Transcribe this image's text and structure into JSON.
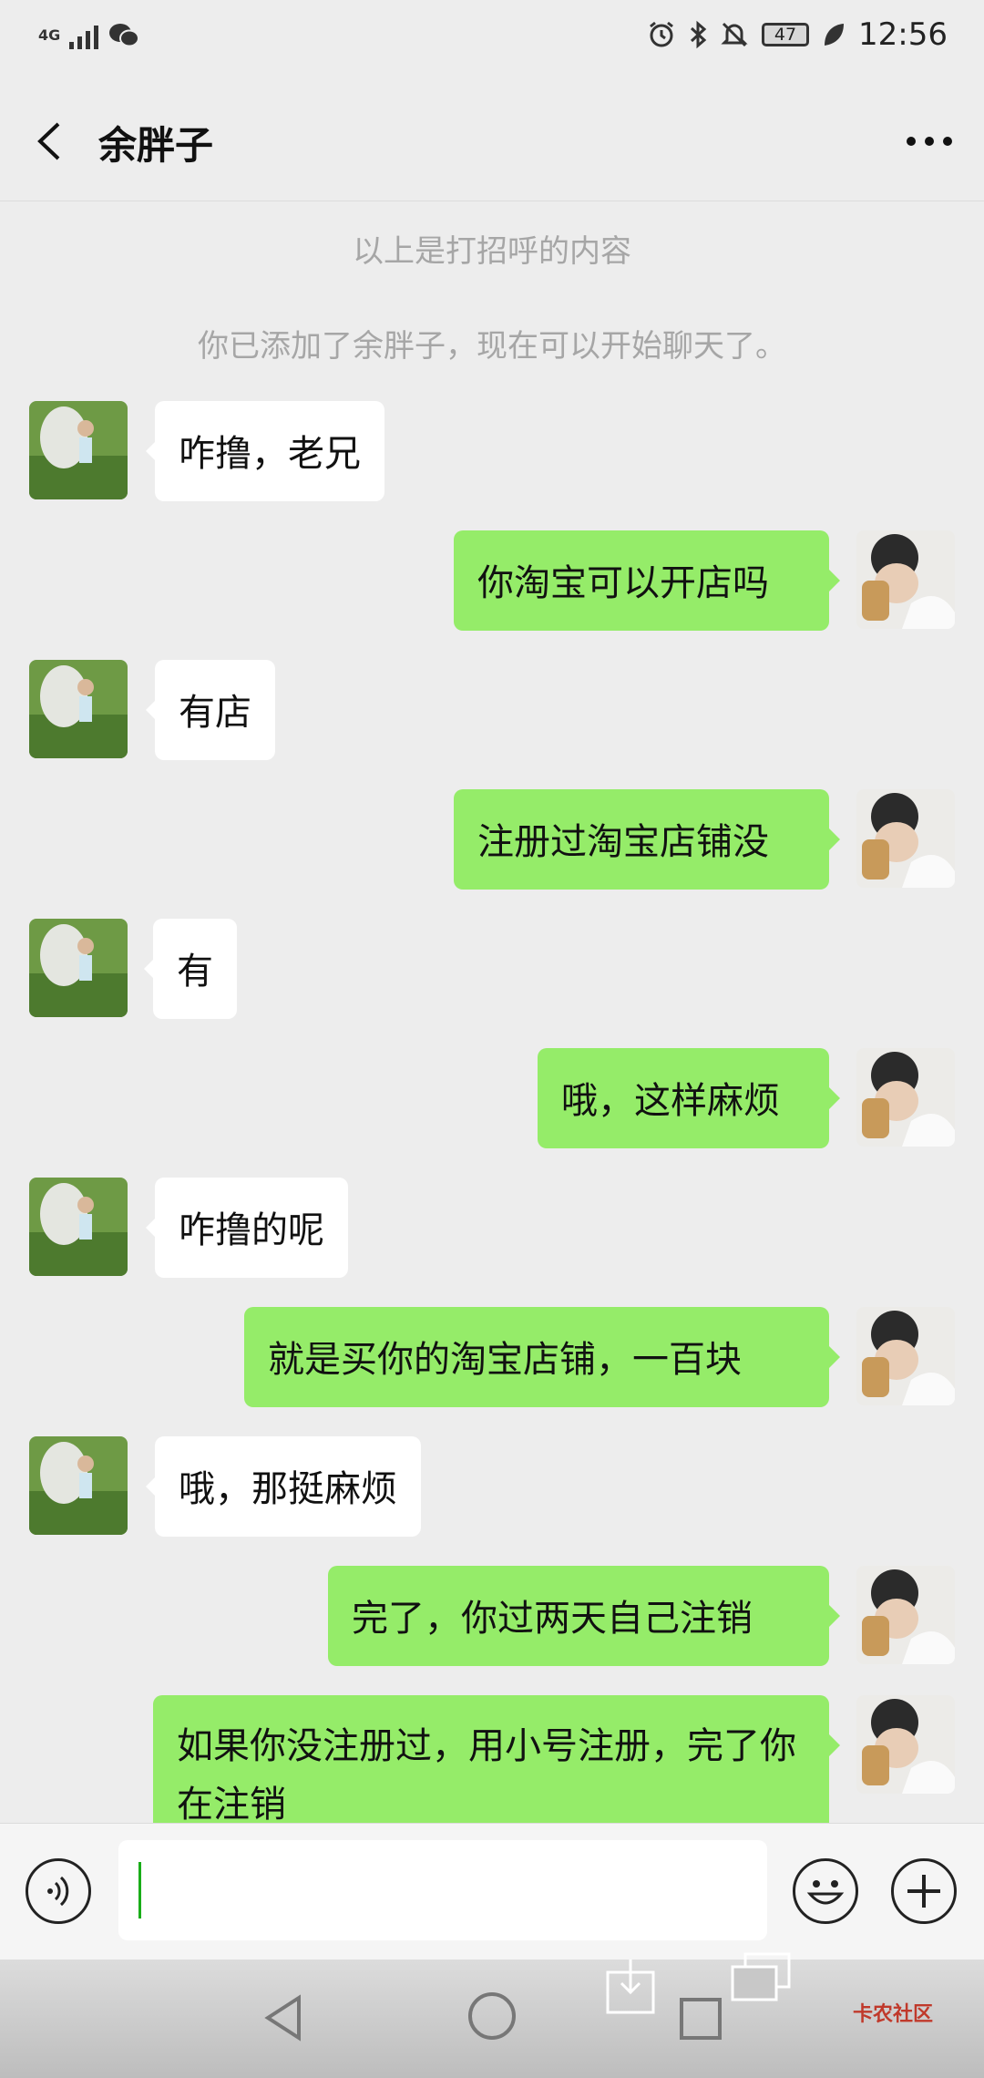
{
  "status_bar": {
    "network": "4G",
    "battery": "47",
    "time": "12:56",
    "icons": [
      "signal-icon",
      "wechat-icon",
      "alarm-icon",
      "bluetooth-icon",
      "mute-icon",
      "battery-icon",
      "leaf-icon"
    ]
  },
  "header": {
    "title": "余胖子",
    "back_icon": "chevron-left-icon",
    "more_icon": "more-dots-icon"
  },
  "system_messages": [
    "以上是打招呼的内容",
    "你已添加了余胖子，现在可以开始聊天了。"
  ],
  "messages": [
    {
      "side": "left",
      "text": "咋撸，老兄"
    },
    {
      "side": "right",
      "text": "你淘宝可以开店吗"
    },
    {
      "side": "left",
      "text": "有店"
    },
    {
      "side": "right",
      "text": "注册过淘宝店铺没"
    },
    {
      "side": "left",
      "text": "有"
    },
    {
      "side": "right",
      "text": "哦，这样麻烦"
    },
    {
      "side": "left",
      "text": "咋撸的呢"
    },
    {
      "side": "right",
      "text": "就是买你的淘宝店铺，一百块"
    },
    {
      "side": "left",
      "text": "哦，那挺麻烦"
    },
    {
      "side": "right",
      "text": "完了，你过两天自己注销"
    },
    {
      "side": "right",
      "text": "如果你没注册过，用小号注册，完了你在注销"
    }
  ],
  "input_bar": {
    "value": "",
    "voice_icon": "voice-icon",
    "emoji_icon": "emoji-icon",
    "plus_icon": "plus-icon"
  },
  "nav_bar": {
    "icons": [
      "back-triangle-icon",
      "home-circle-icon",
      "recents-square-icon",
      "download-icon",
      "copy-icon"
    ],
    "watermark": "卡农社区"
  }
}
